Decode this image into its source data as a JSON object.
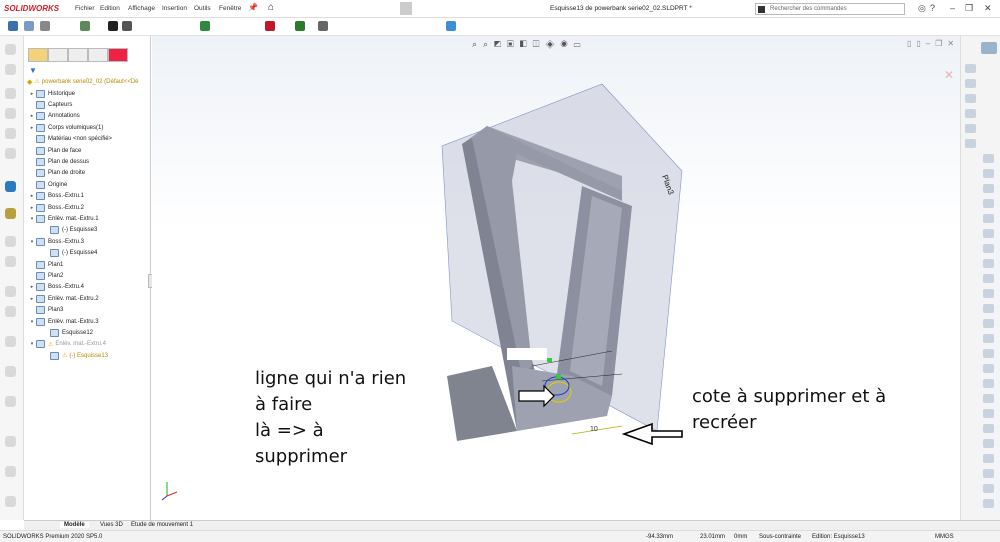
{
  "app": {
    "logo": "SOLIDWORKS",
    "title": "Esquisse13 de powerbank serie02_02.SLDPRT *"
  },
  "menu": [
    "Fichier",
    "Edition",
    "Affichage",
    "Insertion",
    "Outils",
    "Fenêtre"
  ],
  "search": {
    "placeholder": "Rechercher des commandes"
  },
  "tree": {
    "root": "powerbank serie02_02  (Défaut<<Dé",
    "items": [
      {
        "label": "Historique",
        "level": 1,
        "exp": "▸"
      },
      {
        "label": "Capteurs",
        "level": 1,
        "exp": ""
      },
      {
        "label": "Annotations",
        "level": 1,
        "exp": "▸"
      },
      {
        "label": "Corps volumiques(1)",
        "level": 1,
        "exp": "▸"
      },
      {
        "label": "Matériau <non spécifié>",
        "level": 1,
        "exp": ""
      },
      {
        "label": "Plan de face",
        "level": 1,
        "exp": ""
      },
      {
        "label": "Plan de dessus",
        "level": 1,
        "exp": ""
      },
      {
        "label": "Plan de droite",
        "level": 1,
        "exp": ""
      },
      {
        "label": "Origine",
        "level": 1,
        "exp": ""
      },
      {
        "label": "Boss.-Extru.1",
        "level": 1,
        "exp": "▸"
      },
      {
        "label": "Boss.-Extru.2",
        "level": 1,
        "exp": "▸"
      },
      {
        "label": "Enlèv. mat.-Extru.1",
        "level": 1,
        "exp": "▾"
      },
      {
        "label": "(-) Esquisse3",
        "level": 2,
        "exp": ""
      },
      {
        "label": "Boss.-Extru.3",
        "level": 1,
        "exp": "▾"
      },
      {
        "label": "(-) Esquisse4",
        "level": 2,
        "exp": ""
      },
      {
        "label": "Plan1",
        "level": 1,
        "exp": ""
      },
      {
        "label": "Plan2",
        "level": 1,
        "exp": ""
      },
      {
        "label": "Boss.-Extru.4",
        "level": 1,
        "exp": "▸"
      },
      {
        "label": "Enlèv. mat.-Extru.2",
        "level": 1,
        "exp": "▸"
      },
      {
        "label": "Plan3",
        "level": 1,
        "exp": ""
      },
      {
        "label": "Enlèv. mat.-Extru.3",
        "level": 1,
        "exp": "▾"
      },
      {
        "label": "Esquisse12",
        "level": 2,
        "exp": ""
      },
      {
        "label": "Enlèv. mat.-Extru.4",
        "level": 1,
        "exp": "▾",
        "state": "greyed"
      },
      {
        "label": "(-) Esquisse13",
        "level": 2,
        "exp": "",
        "state": "warning"
      }
    ]
  },
  "viewport": {
    "plane_label": "Plan3",
    "dimension": "10",
    "note1": [
      "ligne qui n'a rien à faire",
      "là => à supprimer"
    ],
    "note2": [
      "cote à supprimer et à",
      "recréer"
    ]
  },
  "bottom_tabs": [
    "Modèle",
    "Vues 3D",
    "Etude de mouvement 1"
  ],
  "status": {
    "product": "SOLIDWORKS Premium 2020 SP5.0",
    "x": "-94.33mm",
    "y": "23.01mm",
    "z": "0mm",
    "constraint": "Sous-contrainte",
    "editing": "Edition: Esquisse13",
    "units": "MMGS"
  },
  "colors": {
    "brand": "#d0202a",
    "part": "#8a8e9c",
    "warning": "#e8b400",
    "sketch": "#1a3bd6"
  }
}
